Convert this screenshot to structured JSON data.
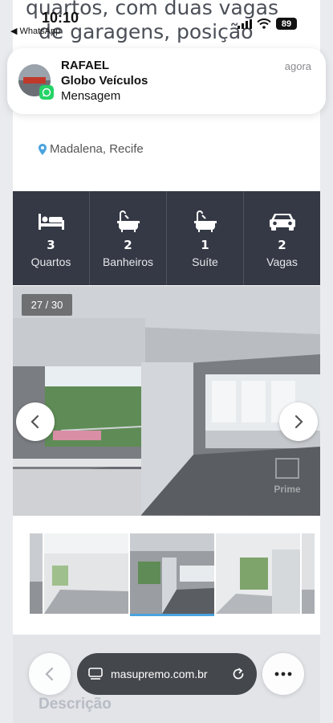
{
  "status_bar": {
    "time": "10:10",
    "back_app": "◀ WhatsApp",
    "battery": "89"
  },
  "listing": {
    "title_line1": "quartos, com duas vagas",
    "title_line2": "de garagens, posição",
    "location": "Madalena, Recife"
  },
  "features": [
    {
      "icon": "bed-icon",
      "count": "3",
      "label": "Quartos"
    },
    {
      "icon": "bathtub-icon",
      "count": "2",
      "label": "Banheiros"
    },
    {
      "icon": "bathtub-icon",
      "count": "1",
      "label": "Suíte"
    },
    {
      "icon": "car-icon",
      "count": "2",
      "label": "Vagas"
    }
  ],
  "gallery": {
    "counter": "27 / 30",
    "watermark": "Prime"
  },
  "notification": {
    "title": "RAFAEL",
    "subtitle": "Globo Veículos",
    "message": "Mensagem",
    "time": "agora"
  },
  "browser": {
    "url": "masupremo.com.br"
  },
  "section": {
    "description_label": "Descrição"
  },
  "colors": {
    "feature_bar": "#343945",
    "accent": "#4aa3df",
    "whatsapp": "#25d366"
  }
}
